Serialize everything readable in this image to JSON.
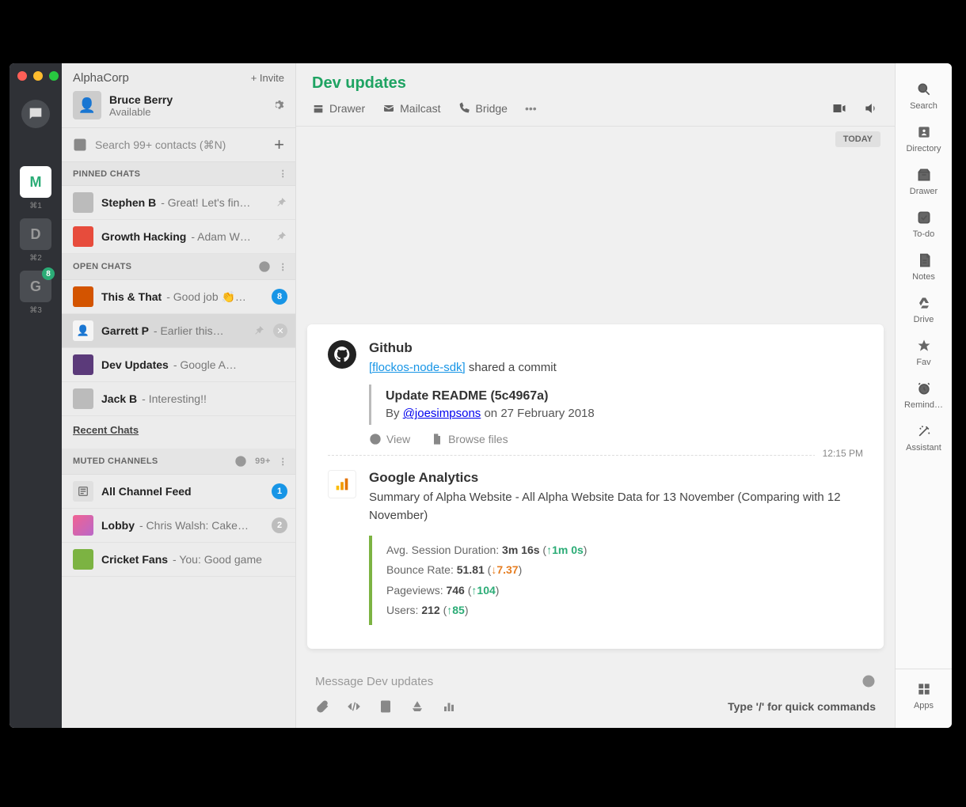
{
  "org": {
    "name": "AlphaCorp",
    "invite": "+ Invite"
  },
  "profile": {
    "name": "Bruce Berry",
    "status": "Available"
  },
  "search": {
    "placeholder": "Search 99+ contacts (⌘N)"
  },
  "workspaces": [
    {
      "letter": "M",
      "shortcut": "⌘1",
      "active": true
    },
    {
      "letter": "D",
      "shortcut": "⌘2",
      "active": false
    },
    {
      "letter": "G",
      "shortcut": "⌘3",
      "active": false,
      "badge": "8"
    }
  ],
  "sections": {
    "pinned": {
      "title": "PINNED CHATS",
      "items": [
        {
          "name": "Stephen B",
          "preview": "- Great! Let's fin…",
          "pin": true,
          "avatar": "dark"
        },
        {
          "name": "Growth Hacking",
          "preview": "- Adam W…",
          "pin": true,
          "avatar": "red"
        }
      ]
    },
    "open": {
      "title": "OPEN CHATS",
      "items": [
        {
          "name": "This & That",
          "preview": "- Good job 👏…",
          "badge": "8",
          "avatar": "orange"
        },
        {
          "name": "Garrett P",
          "preview": "- Earlier this…",
          "pin": true,
          "close": true,
          "selected": true,
          "avatar": "pale"
        },
        {
          "name": "Dev Updates",
          "preview": "- Google A…",
          "avatar": "purple"
        },
        {
          "name": "Jack B",
          "preview": "- Interesting!!",
          "avatar": "dark"
        }
      ],
      "recent": "Recent Chats"
    },
    "muted": {
      "title": "MUTED CHANNELS",
      "count": "99+",
      "items": [
        {
          "name": "All Channel Feed",
          "preview": "",
          "badge": "1",
          "avatar": "feed"
        },
        {
          "name": "Lobby",
          "preview": "- Chris Walsh: Cake…",
          "badge": "2",
          "badge_grey": true,
          "avatar": "pink"
        },
        {
          "name": "Cricket Fans",
          "preview": "- You: Good game",
          "avatar": "green"
        }
      ]
    }
  },
  "channel": {
    "title": "Dev updates",
    "tabs": [
      {
        "icon": "drawer",
        "label": "Drawer"
      },
      {
        "icon": "mail",
        "label": "Mailcast"
      },
      {
        "icon": "phone",
        "label": "Bridge"
      }
    ],
    "separator": "TODAY"
  },
  "messages": {
    "github": {
      "name": "Github",
      "repo_link": "[flockos-node-sdk]",
      "repo_action": " shared a commit",
      "commit_title": "Update README (5c4967a)",
      "by_prefix": "By ",
      "author": "@joesimpsons",
      "date": " on 27 February 2018",
      "view": "View",
      "browse": "Browse files",
      "time": "12:15 PM"
    },
    "ga": {
      "name": "Google Analytics",
      "summary": "Summary of Alpha Website - All Alpha Website Data for 13 November (Comparing with 12 November)",
      "stats": {
        "l1a": "Avg. Session Duration: ",
        "l1b": "3m 16s",
        "l1c": " (",
        "l1d": "↑1m 0s",
        "l1e": ")",
        "l2a": "Bounce Rate: ",
        "l2b": "51.81",
        "l2c": " (",
        "l2d": "↓7.37",
        "l2e": ")",
        "l3a": "Pageviews: ",
        "l3b": "746",
        "l3c": " (",
        "l3d": "↑104",
        "l3e": ")",
        "l4a": "Users: ",
        "l4b": "212",
        "l4c": " (",
        "l4d": "↑85",
        "l4e": ")"
      }
    }
  },
  "composer": {
    "placeholder": "Message Dev updates",
    "hint": "Type '/' for quick commands"
  },
  "right_rail": [
    {
      "icon": "search",
      "label": "Search"
    },
    {
      "icon": "directory",
      "label": "Directory"
    },
    {
      "icon": "drawer",
      "label": "Drawer"
    },
    {
      "icon": "todo",
      "label": "To-do"
    },
    {
      "icon": "notes",
      "label": "Notes"
    },
    {
      "icon": "drive",
      "label": "Drive"
    },
    {
      "icon": "star",
      "label": "Fav"
    },
    {
      "icon": "clock",
      "label": "Remind…"
    },
    {
      "icon": "wand",
      "label": "Assistant"
    }
  ],
  "apps_label": "Apps"
}
